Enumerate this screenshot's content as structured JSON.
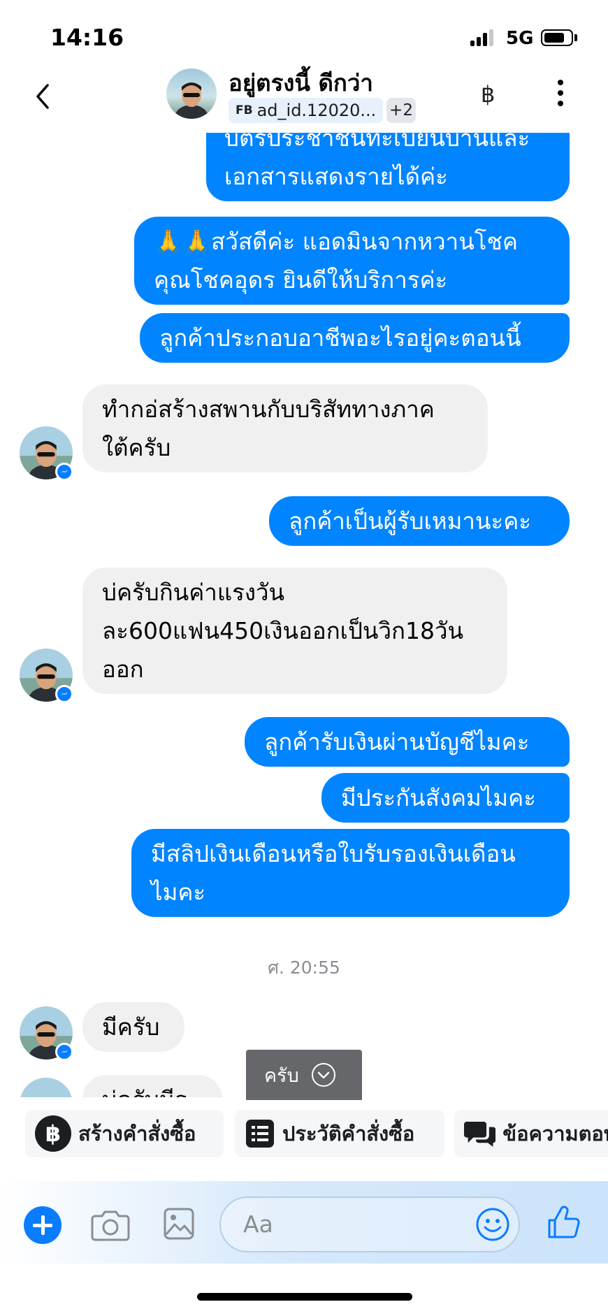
{
  "status_bar": {
    "time": "14:16",
    "network": "5G"
  },
  "header": {
    "contact_name": "อยู่ตรงนี้ ดีกว่า",
    "source_badge": "FB",
    "source_id": "ad_id.12020...",
    "more_count": "+2",
    "baht_symbol": "฿"
  },
  "messages": [
    {
      "side": "out",
      "lines": [
        "บัตรประชาชนทะเบียนบ้านและ",
        "เอกสารแสดงรายได้ค่ะ"
      ]
    },
    {
      "side": "out",
      "lines": [
        "🙏🙏สวัสดีค่ะ แอดมินจากหวานโชค",
        "คุณโชคอุดร ยินดีให้บริการค่ะ"
      ]
    },
    {
      "side": "out",
      "lines": [
        "ลูกค้าประกอบอาชีพอะไรอยู่คะตอนนี้"
      ]
    },
    {
      "side": "in",
      "lines": [
        "ทำกอ่สร้างสพานกับบริสัททางภาค",
        "ใต้ครับ"
      ]
    },
    {
      "side": "out",
      "lines": [
        "ลูกค้าเป็นผู้รับเหมานะคะ"
      ]
    },
    {
      "side": "in",
      "lines": [
        "บ่ครับกินค่าแรงวัน",
        "ละ600แฟน450เงินออกเป็นวิก18วัน",
        "ออก"
      ]
    },
    {
      "side": "out",
      "lines": [
        "ลูกค้ารับเงินผ่านบัญชีไมคะ"
      ]
    },
    {
      "side": "out",
      "lines": [
        "มีประกันสังคมไมคะ"
      ]
    },
    {
      "side": "out",
      "lines": [
        "มีสลิปเงินเดือนหรือใบรับรองเงินเดือน",
        "ไมคะ"
      ]
    },
    {
      "side": "in",
      "lines": [
        "มีครับ"
      ]
    },
    {
      "side": "in",
      "lines": [
        "บ่ครับมีร"
      ]
    }
  ],
  "timestamp": "ศ. 20:55",
  "jump_button": {
    "label": "ครับ"
  },
  "quick_actions": [
    {
      "label": "สร้างคำสั่งซื้อ",
      "icon": "baht-icon"
    },
    {
      "label": "ประวัติคำสั่งซื้อ",
      "icon": "order-list-icon"
    },
    {
      "label": "ข้อความตอบกลับ",
      "icon": "saved-replies-icon"
    }
  ],
  "composer": {
    "placeholder": "Aa"
  },
  "colors": {
    "outgoing": "#0084ff",
    "incoming": "#f0f0f0",
    "accent": "#0a7cff"
  }
}
